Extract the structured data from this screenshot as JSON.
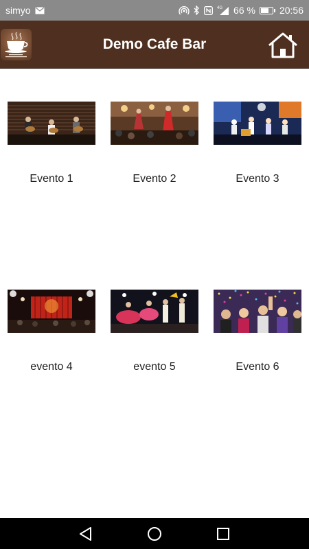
{
  "status_bar": {
    "carrier": "simyo",
    "network": "4G",
    "battery_text": "66 %",
    "battery_level": 0.66,
    "time": "20:56"
  },
  "app_bar": {
    "title": "Demo Cafe Bar",
    "logo_icon": "coffee-cup-logo",
    "home_icon": "home-icon",
    "bg_color": "#4f2f1f"
  },
  "events": [
    {
      "label": "Evento 1",
      "image": "guitarists-on-stage-photo"
    },
    {
      "label": "Evento 2",
      "image": "flamenco-dancer-restaurant-photo"
    },
    {
      "label": "Evento 3",
      "image": "band-concert-blue-lights-photo"
    },
    {
      "label": "evento 4",
      "image": "red-curtain-stage-photo"
    },
    {
      "label": "evento 5",
      "image": "folk-dancers-stage-photo"
    },
    {
      "label": "Evento 6",
      "image": "party-confetti-crowd-photo"
    }
  ],
  "nav_bar": {
    "back_icon": "back-triangle-icon",
    "home_icon": "home-circle-icon",
    "recents_icon": "recents-square-icon"
  }
}
